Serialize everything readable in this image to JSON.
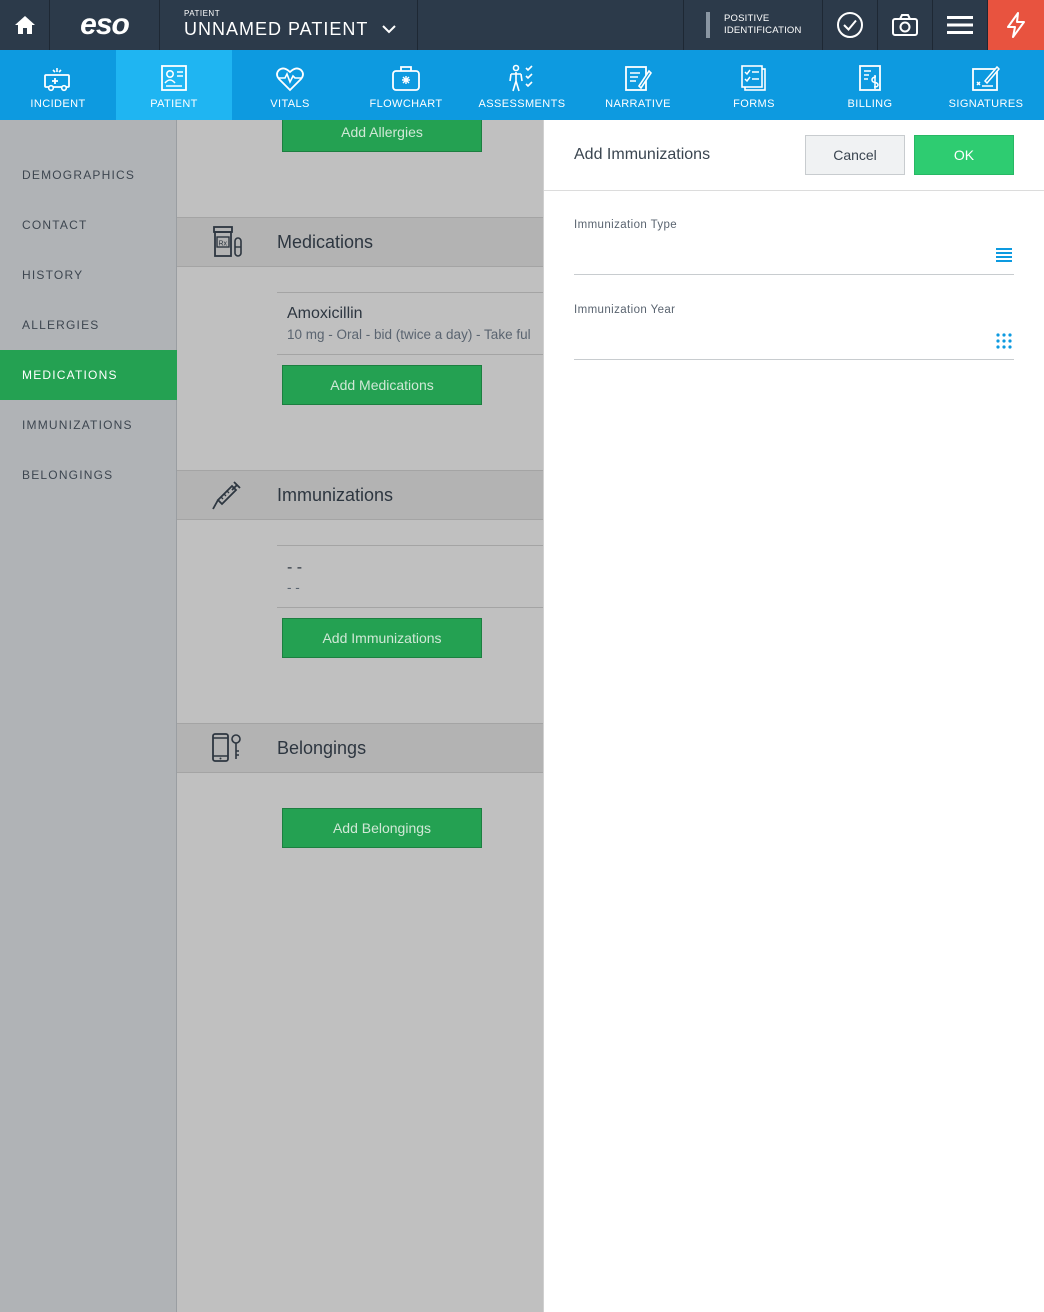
{
  "topbar": {
    "logo": "eso",
    "patient_label": "PATIENT",
    "patient_name": "UNNAMED PATIENT",
    "positive_id_line1": "POSITIVE",
    "positive_id_line2": "IDENTIFICATION"
  },
  "nav": {
    "items": [
      {
        "label": "INCIDENT",
        "icon": "ambulance-icon"
      },
      {
        "label": "PATIENT",
        "icon": "patient-card-icon"
      },
      {
        "label": "VITALS",
        "icon": "heart-pulse-icon"
      },
      {
        "label": "FLOWCHART",
        "icon": "medkit-icon"
      },
      {
        "label": "ASSESSMENTS",
        "icon": "body-check-icon"
      },
      {
        "label": "NARRATIVE",
        "icon": "narrative-pen-icon"
      },
      {
        "label": "FORMS",
        "icon": "forms-check-icon"
      },
      {
        "label": "BILLING",
        "icon": "billing-dollar-icon"
      },
      {
        "label": "SIGNATURES",
        "icon": "signature-icon"
      }
    ],
    "active": "PATIENT"
  },
  "sidebar": {
    "items": [
      {
        "label": "DEMOGRAPHICS"
      },
      {
        "label": "CONTACT"
      },
      {
        "label": "HISTORY"
      },
      {
        "label": "ALLERGIES"
      },
      {
        "label": "MEDICATIONS"
      },
      {
        "label": "IMMUNIZATIONS"
      },
      {
        "label": "BELONGINGS"
      }
    ],
    "active": "MEDICATIONS"
  },
  "main": {
    "add_allergies": "Add Allergies",
    "medications": {
      "title": "Medications",
      "entry_name": "Amoxicillin",
      "entry_detail": "10 mg - Oral - bid (twice a day) - Take ful",
      "add_label": "Add Medications"
    },
    "immunizations": {
      "title": "Immunizations",
      "entry_name": "- -",
      "entry_detail": "- -",
      "add_label": "Add Immunizations"
    },
    "belongings": {
      "title": "Belongings",
      "add_label": "Add Belongings"
    }
  },
  "panel": {
    "title": "Add Immunizations",
    "cancel": "Cancel",
    "ok": "OK",
    "fields": [
      {
        "label": "Immunization Type",
        "value": "",
        "placeholder": "",
        "icon": "list-icon"
      },
      {
        "label": "Immunization Year",
        "value": "",
        "placeholder": "",
        "icon": "keypad-icon"
      }
    ]
  },
  "colors": {
    "topbar": "#2c3a4a",
    "nav": "#0d9ae0",
    "nav_active": "#1fb5f2",
    "green": "#24a152",
    "ok_green": "#2ecc71",
    "alert": "#e8533f",
    "accent_icon": "#0d9ae0"
  }
}
